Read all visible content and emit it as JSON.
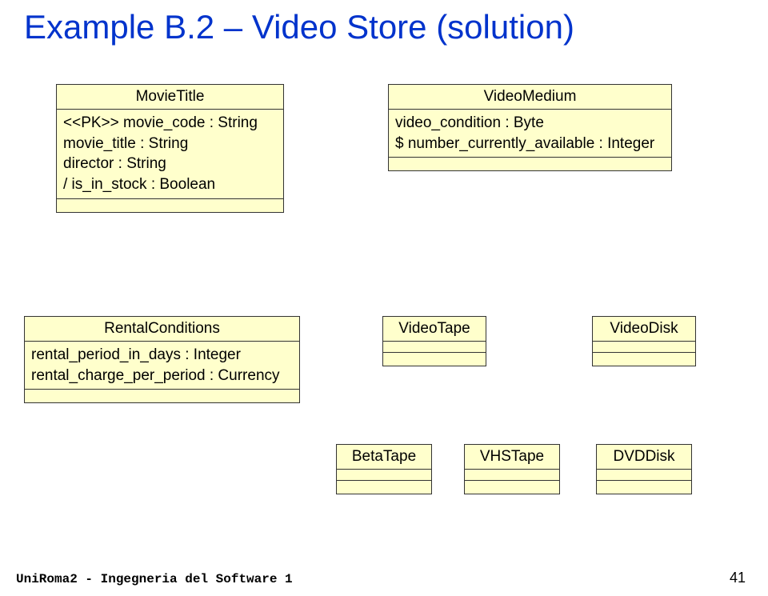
{
  "header": {
    "title": "Example B.2 – Video Store (solution)"
  },
  "classes": {
    "movieTitle": {
      "name": "MovieTitle",
      "attrs": [
        "<<PK>> movie_code : String",
        "movie_title : String",
        "director : String",
        "/ is_in_stock : Boolean"
      ]
    },
    "videoMedium": {
      "name": "VideoMedium",
      "attrs": [
        "video_condition : Byte",
        "$ number_currently_available : Integer"
      ]
    },
    "rentalConditions": {
      "name": "RentalConditions",
      "attrs": [
        "rental_period_in_days : Integer",
        "rental_charge_per_period : Currency"
      ]
    },
    "videoTape": {
      "name": "VideoTape"
    },
    "videoDisk": {
      "name": "VideoDisk"
    },
    "betaTape": {
      "name": "BetaTape"
    },
    "vhsTape": {
      "name": "VHSTape"
    },
    "dvdDisk": {
      "name": "DVDDisk"
    }
  },
  "footer": {
    "text": "UniRoma2 - Ingegneria del Software 1",
    "page": "41"
  }
}
